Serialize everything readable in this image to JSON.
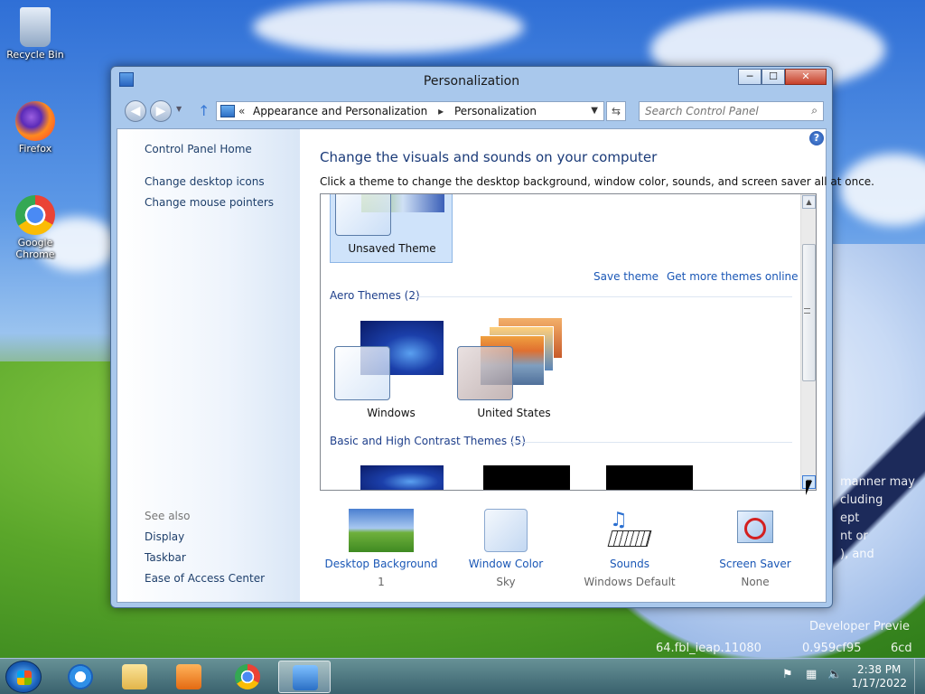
{
  "desktop": {
    "icons": [
      {
        "label": "Recycle Bin",
        "icon": "recycle-bin-icon"
      },
      {
        "label": "Firefox",
        "icon": "firefox-icon"
      },
      {
        "label": "Google Chrome",
        "icon": "chrome-icon"
      }
    ],
    "watermark_lines": [
      "manner may",
      "cluding",
      "ept",
      "nt or",
      "), and",
      "Developer Previe",
      "64.fbl_ieap.11080",
      "0.959cf95",
      "6cd"
    ]
  },
  "window": {
    "title": "Personalization",
    "caption_buttons": {
      "minimize": "─",
      "maximize": "☐",
      "close": "✕"
    },
    "nav": {
      "back": "◀",
      "forward": "▶",
      "breadcrumb": [
        "Appearance and Personalization",
        "Personalization"
      ],
      "search_placeholder": "Search Control Panel"
    },
    "left_pane": {
      "links": [
        "Control Panel Home",
        "Change desktop icons",
        "Change mouse pointers"
      ],
      "see_also_label": "See also",
      "see_also": [
        "Display",
        "Taskbar",
        "Ease of Access Center"
      ]
    },
    "main": {
      "title": "Change the visuals and sounds on your computer",
      "description": "Click a theme to change the desktop background, window color, sounds, and screen saver all at once.",
      "unsaved_theme": "Unsaved Theme",
      "save_theme": "Save theme",
      "get_more": "Get more themes online",
      "aero_header": "Aero Themes (2)",
      "aero_themes": [
        "Windows",
        "United States"
      ],
      "basic_header": "Basic and High Contrast Themes (5)"
    },
    "bottom": [
      {
        "label": "Desktop Background",
        "value": "1",
        "icon": "desktop-background-icon"
      },
      {
        "label": "Window Color",
        "value": "Sky",
        "icon": "window-color-icon"
      },
      {
        "label": "Sounds",
        "value": "Windows Default",
        "icon": "sounds-icon"
      },
      {
        "label": "Screen Saver",
        "value": "None",
        "icon": "screen-saver-icon"
      }
    ]
  },
  "taskbar": {
    "apps": [
      "Internet Explorer",
      "File Explorer",
      "Windows Media Player",
      "Google Chrome",
      "Control Panel"
    ],
    "clock_time": "2:38 PM",
    "clock_date": "1/17/2022",
    "tray_flag": "⚑"
  },
  "colors": {
    "accent": "#1a57b6",
    "heading": "#1a3a78"
  }
}
